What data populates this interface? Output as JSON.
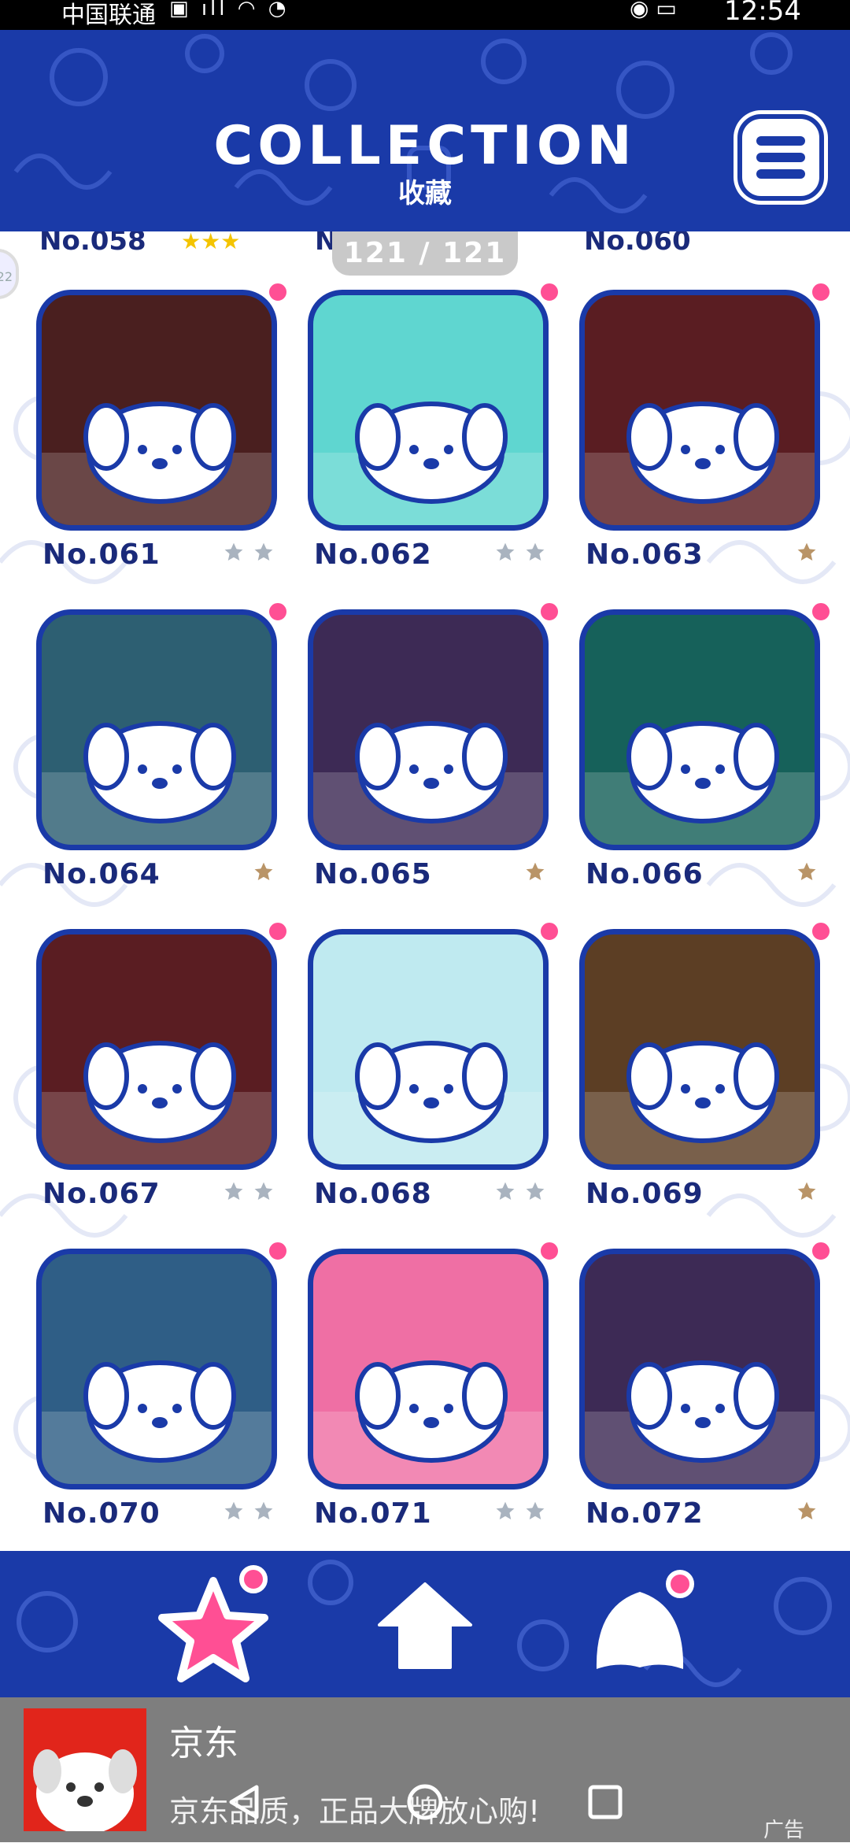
{
  "status_bar": {
    "carrier": "中国联通",
    "time": "12:54"
  },
  "header": {
    "title": "COLLECTION",
    "subtitle": "收藏"
  },
  "counter": {
    "text": "121 / 121"
  },
  "side_tab": {
    "text": "22"
  },
  "partial_row": {
    "left": "No.058",
    "mid": "N",
    "right": "No.060"
  },
  "cards": [
    {
      "label": "No.061",
      "stars": 2,
      "filled": false,
      "bg": "#4a1f1f"
    },
    {
      "label": "No.062",
      "stars": 2,
      "filled": false,
      "bg": "#5fd6d0"
    },
    {
      "label": "No.063",
      "stars": 1,
      "filled": true,
      "bg": "#5a1d22"
    },
    {
      "label": "No.064",
      "stars": 1,
      "filled": true,
      "bg": "#2d5f72"
    },
    {
      "label": "No.065",
      "stars": 1,
      "filled": true,
      "bg": "#3d2a55"
    },
    {
      "label": "No.066",
      "stars": 1,
      "filled": true,
      "bg": "#16615a"
    },
    {
      "label": "No.067",
      "stars": 2,
      "filled": false,
      "bg": "#5a1d22"
    },
    {
      "label": "No.068",
      "stars": 2,
      "filled": false,
      "bg": "#bfeaf0"
    },
    {
      "label": "No.069",
      "stars": 1,
      "filled": true,
      "bg": "#5c3e24"
    },
    {
      "label": "No.070",
      "stars": 2,
      "filled": false,
      "bg": "#2f5e86"
    },
    {
      "label": "No.071",
      "stars": 2,
      "filled": false,
      "bg": "#ef6fa4"
    },
    {
      "label": "No.072",
      "stars": 1,
      "filled": true,
      "bg": "#3d2a55"
    }
  ],
  "nav": {
    "items": [
      "collection-star-icon",
      "home-icon",
      "character-icon"
    ]
  },
  "ad": {
    "title": "京东",
    "desc": "京东品质，正品大牌放心购!",
    "mark": "广告"
  },
  "colors": {
    "brand_blue": "#1a3aa8",
    "accent_pink": "#ff4f94",
    "star_gold": "#b99467",
    "star_gray": "#a9b3bf",
    "label_navy": "#1a2a7a"
  }
}
